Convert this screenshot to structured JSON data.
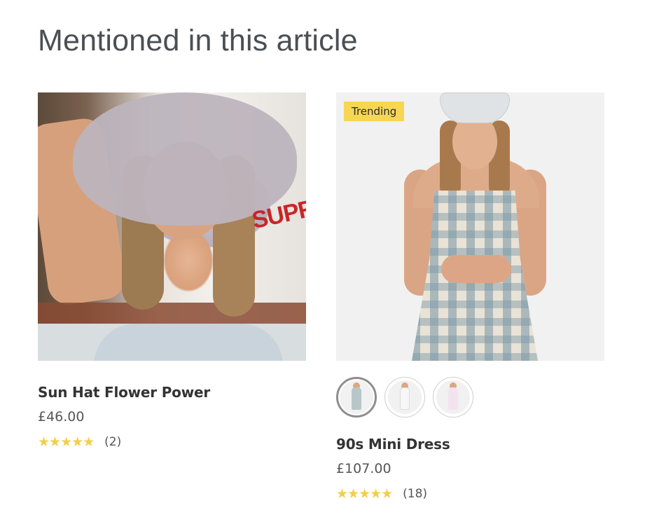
{
  "section": {
    "title": "Mentioned in this article"
  },
  "products": [
    {
      "title": "Sun Hat Flower Power",
      "price": "£46.00",
      "rating_stars": 5,
      "review_count": "(2)",
      "image_icon": "model-in-floral-sun-hat",
      "sign_text": "SUPREM"
    },
    {
      "badge": "Trending",
      "title": "90s Mini Dress",
      "price": "£107.00",
      "rating_stars": 5,
      "review_count": "(18)",
      "image_icon": "model-in-check-mini-dress",
      "swatches": [
        {
          "name": "blue-check",
          "selected": true,
          "color": "#b9c6c9"
        },
        {
          "name": "white",
          "selected": false,
          "color": "#f7f7f7"
        },
        {
          "name": "pink",
          "selected": false,
          "color": "#f3e3ee"
        }
      ]
    }
  ],
  "colors": {
    "badge": "#f7d752",
    "star": "#f2cf4a",
    "title_text": "#4a4f54"
  }
}
